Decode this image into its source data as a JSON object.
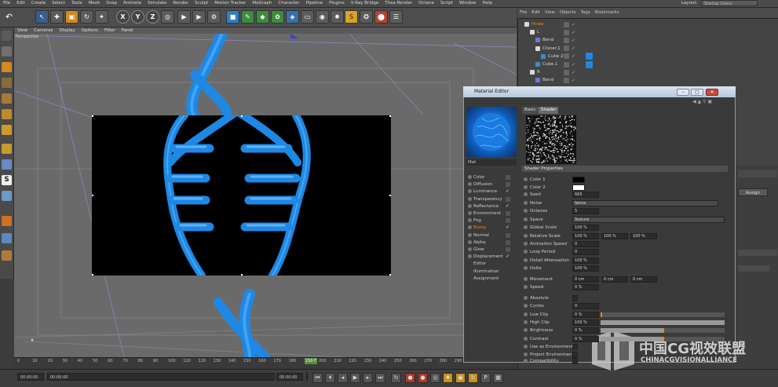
{
  "menu": [
    "File",
    "Edit",
    "Create",
    "Select",
    "Tools",
    "Mesh",
    "Snap",
    "Animate",
    "Simulate",
    "Render",
    "Sculpt",
    "Motion Tracker",
    "MoGraph",
    "Character",
    "Pipeline",
    "Plugins",
    "V-Ray Bridge",
    "Thea Render",
    "Octane",
    "Script",
    "Window",
    "Help"
  ],
  "layout": {
    "label": "Layout:",
    "value": "Startup (User)"
  },
  "toolbar_axes": [
    "X",
    "Y",
    "Z"
  ],
  "viewport": {
    "menu": [
      "View",
      "Cameras",
      "Display",
      "Options",
      "Filter",
      "Panel"
    ],
    "label": "Perspective"
  },
  "timeline": {
    "ticks": [
      "0",
      "10",
      "20",
      "30",
      "40",
      "50",
      "60",
      "70",
      "80",
      "90",
      "100",
      "110",
      "120",
      "130",
      "140",
      "150",
      "160",
      "170",
      "180",
      "190",
      "200",
      "210",
      "220",
      "230",
      "240",
      "250",
      "260",
      "270",
      "280",
      "290",
      "300",
      "310",
      "320"
    ],
    "current_frame": "150 F",
    "fields": {
      "start": "00:00:00",
      "current": "00:00:00",
      "end": "00:00:00",
      "max": "00:00:00"
    }
  },
  "object_manager": {
    "menu": [
      "File",
      "Edit",
      "View",
      "Objects",
      "Tags",
      "Bookmarks"
    ],
    "rows": [
      {
        "name": "Hnwe",
        "indent": 0
      },
      {
        "name": "L",
        "indent": 1
      },
      {
        "name": "Bend",
        "indent": 2
      },
      {
        "name": "Cloner.1",
        "indent": 2
      },
      {
        "name": "Cube 2",
        "indent": 3
      },
      {
        "name": "Cube.1",
        "indent": 2
      },
      {
        "name": "R",
        "indent": 1
      },
      {
        "name": "Bend",
        "indent": 2
      }
    ]
  },
  "attribute": {
    "assign_label": "Assign"
  },
  "material_editor": {
    "title": "Material Editor",
    "material_name": "Mat",
    "channels": [
      {
        "label": "Color",
        "checked": false
      },
      {
        "label": "Diffusion",
        "checked": false
      },
      {
        "label": "Luminance",
        "checked": true
      },
      {
        "label": "Transparency",
        "checked": false
      },
      {
        "label": "Reflectance",
        "checked": true
      },
      {
        "label": "Environment",
        "checked": false
      },
      {
        "label": "Fog",
        "checked": false
      },
      {
        "label": "Bump",
        "checked": true,
        "active": true
      },
      {
        "label": "Normal",
        "checked": false
      },
      {
        "label": "Alpha",
        "checked": false
      },
      {
        "label": "Glow",
        "checked": false
      },
      {
        "label": "Displacement",
        "checked": true
      },
      {
        "label": "Editor",
        "checked": false,
        "plain": true
      },
      {
        "label": "Illumination",
        "checked": false,
        "plain": true
      },
      {
        "label": "Assignment",
        "checked": false,
        "plain": true
      }
    ],
    "tabs": [
      "Basic",
      "Shader"
    ],
    "active_tab": "Shader",
    "section": "Shader Properties",
    "properties": [
      {
        "label": "Color 1",
        "type": "color",
        "value": "#000000"
      },
      {
        "label": "Color 2",
        "type": "color",
        "value": "#ffffff"
      },
      {
        "label": "Seed",
        "type": "num",
        "value": "665"
      },
      {
        "label": "Noise",
        "type": "select",
        "value": "Sema"
      },
      {
        "label": "Octaves",
        "type": "num",
        "value": "5"
      },
      {
        "label": "Space",
        "type": "select",
        "value": "Texture"
      },
      {
        "label": "Global Scale",
        "type": "num",
        "value": "100 %"
      },
      {
        "label": "Relative Scale",
        "type": "vec",
        "values": [
          "100 %",
          "100 %",
          "100 %"
        ]
      },
      {
        "label": "Animation Speed",
        "type": "num",
        "value": "0"
      },
      {
        "label": "Loop Period",
        "type": "num",
        "value": "0"
      },
      {
        "label": "Detail Attenuation",
        "type": "num",
        "value": "100 %"
      },
      {
        "label": "Delta",
        "type": "num",
        "value": "100 %"
      },
      {
        "label": "Movement",
        "type": "vec",
        "values": [
          "0 cm",
          "0 cm",
          "0 cm"
        ]
      },
      {
        "label": "Speed",
        "type": "num",
        "value": "0 %"
      },
      {
        "label": "Absolute",
        "type": "check",
        "value": ""
      },
      {
        "label": "Cycles",
        "type": "num",
        "value": "0"
      },
      {
        "label": "Low Clip",
        "type": "bar",
        "value": "0 %",
        "level": 0
      },
      {
        "label": "High Clip",
        "type": "bar",
        "value": "100 %",
        "level": 1
      },
      {
        "label": "Brightness",
        "type": "bar",
        "value": "0 %",
        "level": 0.5
      },
      {
        "label": "Contrast",
        "type": "bar",
        "value": "0 %",
        "level": 0.5
      },
      {
        "label": "Use as Environment",
        "type": "check",
        "value": ""
      },
      {
        "label": "Project Environment",
        "type": "check",
        "value": ""
      },
      {
        "label": "Compatibility",
        "type": "check",
        "value": ""
      }
    ]
  },
  "watermark": {
    "line1": "中国CG视效联盟",
    "line2": "CHINACGVISIONALLIANCE"
  },
  "colors": {
    "helix": "#1e88e5",
    "helix_light": "#5ab4ff",
    "accent_orange": "#e08a1e"
  }
}
